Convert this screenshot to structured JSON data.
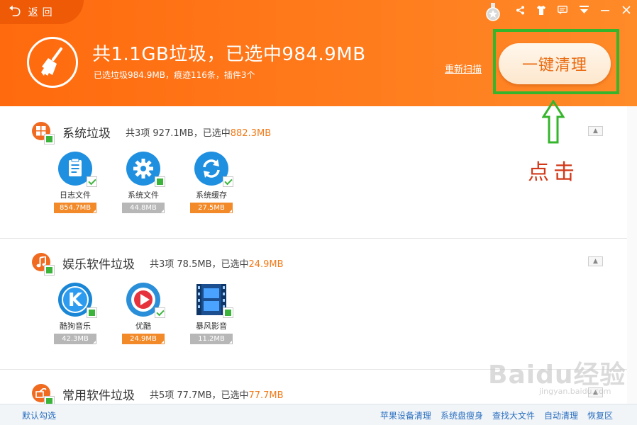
{
  "header": {
    "back_label": "返回",
    "title": "共1.1GB垃圾，已选中984.9MB",
    "subtitle": "已选垃圾984.9MB，痕迹116条，插件3个",
    "rescan_label": "重新扫描",
    "clean_button_label": "一键清理"
  },
  "annotation": {
    "text": "点击",
    "color": "#d23818",
    "box_color": "#35b52c"
  },
  "sections": [
    {
      "title": "系统垃圾",
      "summary_prefix": "共3项 927.1MB，已选中",
      "summary_selected": "882.3MB",
      "items": [
        {
          "label": "日志文件",
          "size": "854.7MB",
          "state": "checked",
          "icon": "log-file-icon"
        },
        {
          "label": "系统文件",
          "size": "44.8MB",
          "state": "partial",
          "icon": "gear-icon"
        },
        {
          "label": "系统缓存",
          "size": "27.5MB",
          "state": "checked",
          "icon": "refresh-icon"
        }
      ]
    },
    {
      "title": "娱乐软件垃圾",
      "summary_prefix": "共3项 78.5MB，已选中",
      "summary_selected": "24.9MB",
      "items": [
        {
          "label": "酷狗音乐",
          "size": "42.3MB",
          "state": "partial",
          "icon": "kugou-icon"
        },
        {
          "label": "优酷",
          "size": "24.9MB",
          "state": "checked",
          "icon": "youku-icon"
        },
        {
          "label": "暴风影音",
          "size": "11.2MB",
          "state": "partial",
          "icon": "baofeng-icon"
        }
      ]
    },
    {
      "title": "常用软件垃圾",
      "summary_prefix": "共5项 77.7MB，已选中",
      "summary_selected": "77.7MB"
    }
  ],
  "footer": {
    "default_check_label": "默认勾选",
    "links": [
      "苹果设备清理",
      "系统盘瘦身",
      "查找大文件",
      "自动清理",
      "恢复区"
    ]
  },
  "watermark": {
    "text": "Baidu经验",
    "sub": "jingyan.baidu.com"
  },
  "colors": {
    "header_orange": "#ff7416",
    "selected_size": "#f28a2a",
    "unselected_size": "#b7b7b7",
    "check_green": "#3cb43c",
    "link_blue": "#2a6fc0"
  }
}
